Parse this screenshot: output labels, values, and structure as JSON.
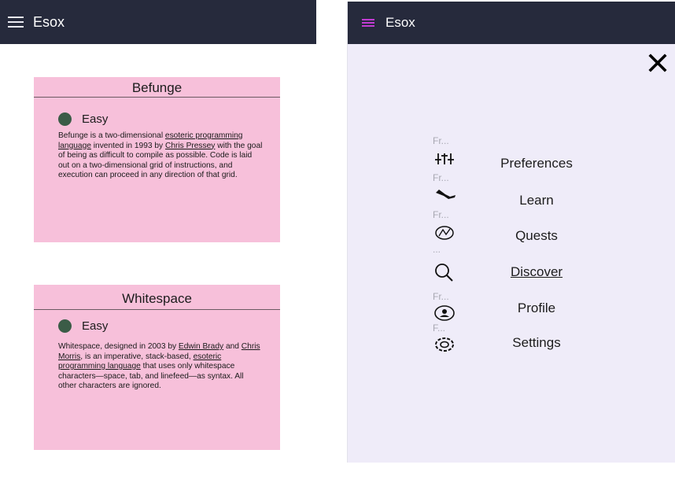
{
  "left_app": {
    "title": "Esox",
    "cards": [
      {
        "title": "Befunge",
        "difficulty": "Easy",
        "desc_parts": {
          "p1": "Befunge is a two-dimensional ",
          "link1": "esoteric programming language",
          "p2": " invented in 1993 by ",
          "link2": "Chris Pressey",
          "p3": " with the goal of being as difficult to compile as possible. Code is laid out on a two-dimensional grid of instructions, and execution can proceed in any direction of that grid."
        }
      },
      {
        "title": "Whitespace",
        "difficulty": "Easy",
        "desc_parts": {
          "p1": "Whitespace, designed in 2003 by ",
          "link1": "Edwin Brady",
          "p2": " and ",
          "link2": "Chris Morris",
          "p3": ", is an imperative, stack-based, ",
          "link3": "esoteric programming language",
          "p4": " that uses only whitespace characters—space, tab, and linefeed—as syntax. All other characters are ignored."
        }
      }
    ]
  },
  "right_app": {
    "title": "Esox",
    "close_icon": "close-icon",
    "nav": [
      {
        "tooltip": "Fr...",
        "icon": "sliders-icon",
        "label": "Preferences"
      },
      {
        "tooltip": "Fr...",
        "icon": "learn-icon",
        "label": "Learn"
      },
      {
        "tooltip": "Fr...",
        "icon": "quests-icon",
        "label": "Quests"
      },
      {
        "tooltip": "...",
        "icon": "search-icon",
        "label": "Discover"
      },
      {
        "tooltip": "Fr...",
        "icon": "profile-icon",
        "label": "Profile"
      },
      {
        "tooltip": "F...",
        "icon": "settings-icon",
        "label": "Settings"
      }
    ]
  },
  "colors": {
    "appbar": "#262a3c",
    "card_bg": "#f7c0da",
    "difficulty_dot": "#3b5c47",
    "drawer_bg": "#efecf9",
    "menu_accent": "#c03cd2"
  }
}
